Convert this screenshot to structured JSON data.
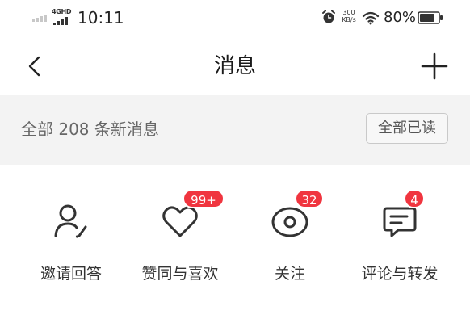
{
  "status_bar": {
    "network": "4GHD",
    "time": "10:11",
    "speed_value": "300",
    "speed_unit": "KB/s",
    "battery": "80%",
    "battery_level": 0.8,
    "icons": [
      "signal-icon",
      "signal-4g-icon",
      "alarm-icon",
      "wifi-icon",
      "battery-icon"
    ]
  },
  "nav": {
    "title": "消息",
    "back_icon": "chevron-left-icon",
    "add_icon": "plus-icon"
  },
  "summary": {
    "text": "全部 208 条新消息",
    "mark_all_read": "全部已读"
  },
  "categories": [
    {
      "label": "邀请回答",
      "icon": "invite-answer-icon",
      "badge": ""
    },
    {
      "label": "赞同与喜欢",
      "icon": "heart-icon",
      "badge": "99+"
    },
    {
      "label": "关注",
      "icon": "eye-icon",
      "badge": "32"
    },
    {
      "label": "评论与转发",
      "icon": "comment-icon",
      "badge": "4"
    }
  ],
  "colors": {
    "badge": "#f0353f",
    "summary_bg": "#f3f3f3",
    "icon_stroke": "#333333"
  }
}
